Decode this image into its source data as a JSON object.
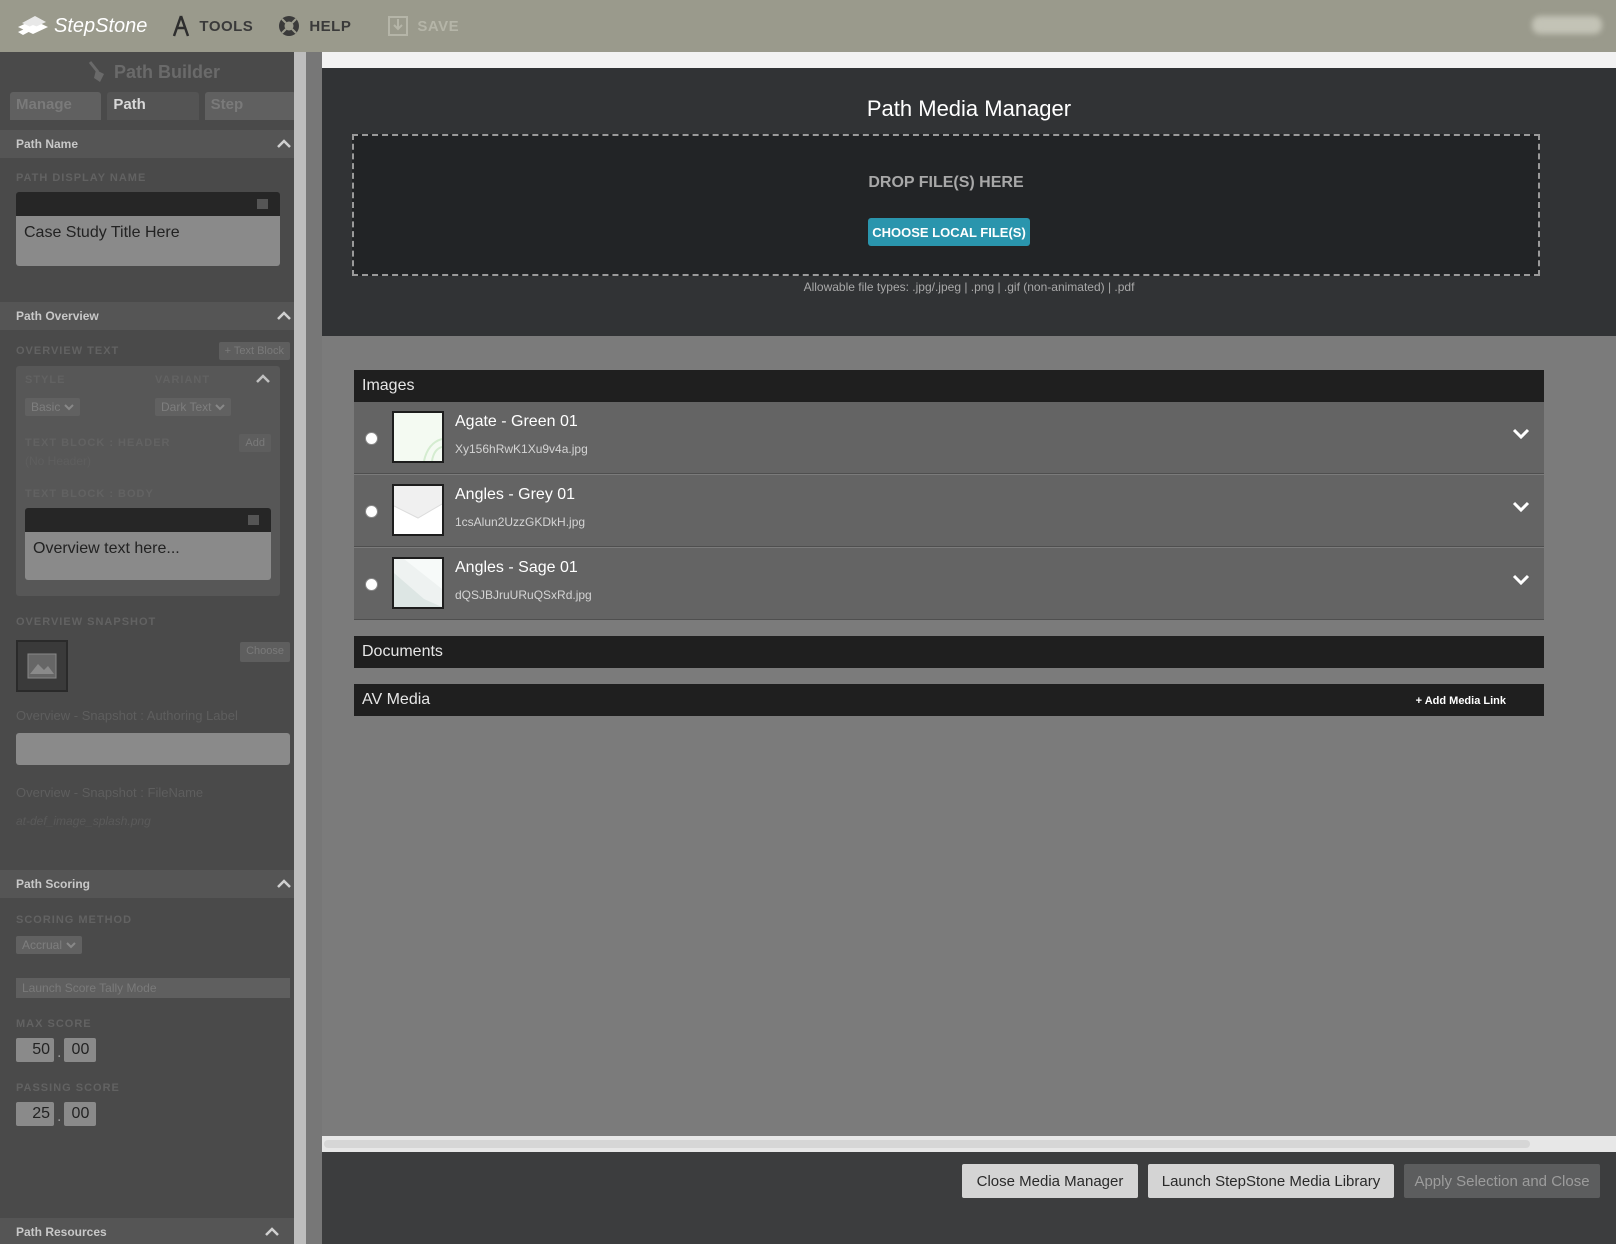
{
  "topbar": {
    "brand": "StepStone",
    "tools": "TOOLS",
    "help": "HELP",
    "save": "SAVE"
  },
  "sidebar": {
    "title": "Path Builder",
    "tabs": [
      "Manage",
      "Path",
      "Step"
    ],
    "path_name": {
      "header": "Path Name",
      "display_name_label": "PATH DISPLAY NAME",
      "display_name_value": "Case Study Title Here"
    },
    "path_overview": {
      "header": "Path Overview",
      "overview_text_label": "OVERVIEW TEXT",
      "text_block_btn": "+ Text Block",
      "style_label": "STYLE",
      "variant_label": "VARIANT",
      "style_value": "Basic",
      "variant_value": "Dark Text",
      "tb_header_label": "TEXT BLOCK : HEADER",
      "add_btn": "Add",
      "no_header": "(No Header)",
      "tb_body_label": "TEXT BLOCK : BODY",
      "body_value": "Overview text here...",
      "snapshot_label": "OVERVIEW SNAPSHOT",
      "choose_btn": "Choose",
      "authoring_label": "Overview - Snapshot : Authoring Label",
      "filename_label": "Overview - Snapshot : FileName",
      "filename_value": "at-def_image_splash.png"
    },
    "path_scoring": {
      "header": "Path Scoring",
      "method_label": "SCORING METHOD",
      "method_value": "Accrual",
      "tally_btn": "Launch Score Tally Mode",
      "max_label": "MAX SCORE",
      "max_int": "50",
      "max_dec": "00",
      "pass_label": "PASSING SCORE",
      "pass_int": "25",
      "pass_dec": "00"
    },
    "path_resources": {
      "header": "Path Resources"
    }
  },
  "main": {
    "title": "Path Media Manager",
    "drop_text": "DROP FILE(S) HERE",
    "choose_btn": "CHOOSE LOCAL FILE(S)",
    "allowable": "Allowable file types: .jpg/.jpeg | .png | .gif (non-animated) | .pdf",
    "images_header": "Images",
    "images": [
      {
        "title": "Agate - Green 01",
        "file": "Xy156hRwK1Xu9v4a.jpg"
      },
      {
        "title": "Angles - Grey 01",
        "file": "1csAlun2UzzGKDkH.jpg"
      },
      {
        "title": "Angles - Sage 01",
        "file": "dQSJBJruURuQSxRd.jpg"
      }
    ],
    "documents_header": "Documents",
    "av_header": "AV Media",
    "add_media_link": "+ Add Media Link"
  },
  "footer": {
    "close": "Close Media Manager",
    "launch": "Launch StepStone Media Library",
    "apply": "Apply Selection and Close"
  }
}
